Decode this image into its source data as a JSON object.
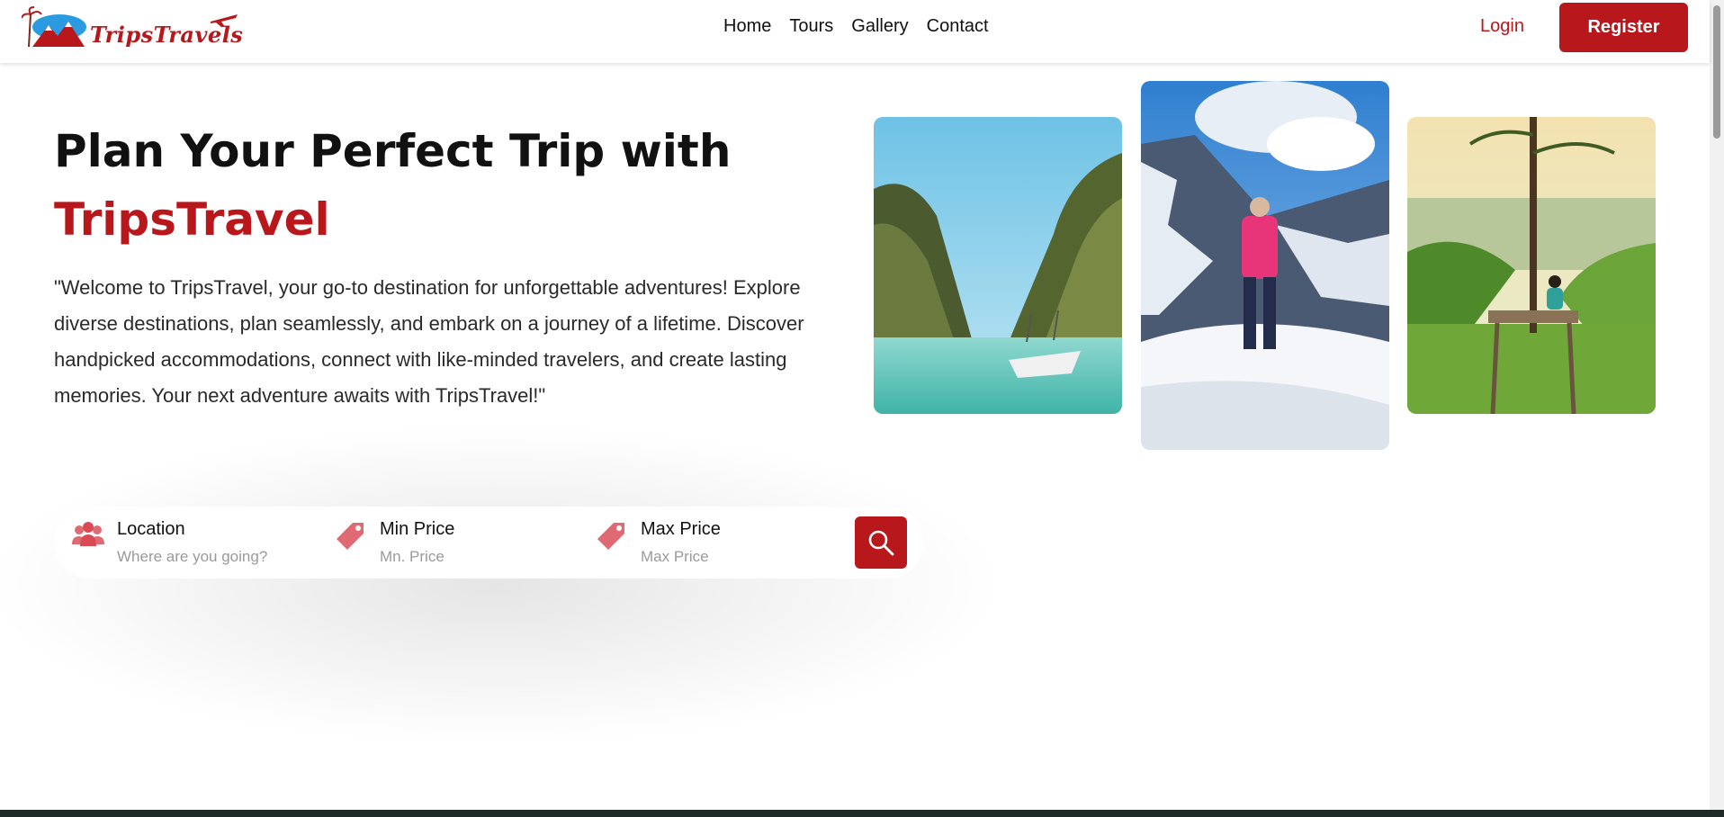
{
  "header": {
    "logo_text": "TripsTravels",
    "nav": [
      "Home",
      "Tours",
      "Gallery",
      "Contact"
    ],
    "login": "Login",
    "register": "Register"
  },
  "hero": {
    "title_line1": "Plan Your Perfect Trip with",
    "title_brand": "TripsTravel",
    "description": "\"Welcome to TripsTravel, your go-to destination for unforgettable adventures! Explore diverse destinations, plan seamlessly, and embark on a journey of a lifetime. Discover handpicked accommodations, connect with like-minded travelers, and create lasting memories. Your next adventure awaits with TripsTravel!\""
  },
  "search": {
    "location": {
      "label": "Location",
      "placeholder": "Where are you going?",
      "icon": "people-icon"
    },
    "min_price": {
      "label": "Min Price",
      "placeholder": "Mn. Price",
      "icon": "price-tag-icon"
    },
    "max_price": {
      "label": "Max Price",
      "placeholder": "Max Price",
      "icon": "price-tag-icon"
    },
    "button_icon": "search-icon"
  },
  "colors": {
    "brand": "#b8171c",
    "text": "#111111",
    "muted": "#9a9a9a"
  }
}
